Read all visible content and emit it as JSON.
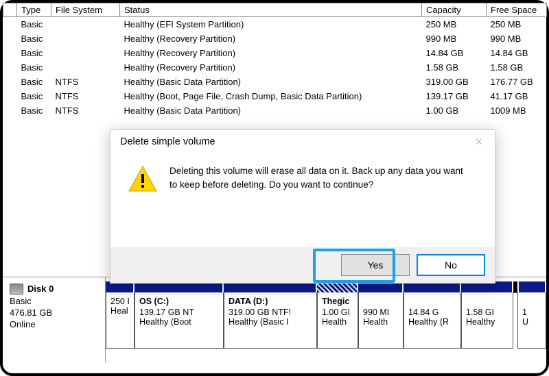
{
  "columns": {
    "type": "Type",
    "fs": "File System",
    "status": "Status",
    "capacity": "Capacity",
    "free": "Free Space"
  },
  "rows": [
    {
      "type": "Basic",
      "fs": "",
      "status": "Healthy (EFI System Partition)",
      "cap": "250 MB",
      "free": "250 MB"
    },
    {
      "type": "Basic",
      "fs": "",
      "status": "Healthy (Recovery Partition)",
      "cap": "990 MB",
      "free": "990 MB"
    },
    {
      "type": "Basic",
      "fs": "",
      "status": "Healthy (Recovery Partition)",
      "cap": "14.84 GB",
      "free": "14.84 GB"
    },
    {
      "type": "Basic",
      "fs": "",
      "status": "Healthy (Recovery Partition)",
      "cap": "1.58 GB",
      "free": "1.58 GB"
    },
    {
      "type": "Basic",
      "fs": "NTFS",
      "status": "Healthy (Basic Data Partition)",
      "cap": "319.00 GB",
      "free": "176.77 GB"
    },
    {
      "type": "Basic",
      "fs": "NTFS",
      "status": "Healthy (Boot, Page File, Crash Dump, Basic Data Partition)",
      "cap": "139.17 GB",
      "free": "41.17 GB"
    },
    {
      "type": "Basic",
      "fs": "NTFS",
      "status": "Healthy (Basic Data Partition)",
      "cap": "1.00 GB",
      "free": "1009 MB"
    }
  ],
  "dialog": {
    "title": "Delete simple volume",
    "message": "Deleting this volume will erase all data on it. Back up any data you want to keep before deleting. Do you want to continue?",
    "yes": "Yes",
    "no": "No"
  },
  "disk": {
    "name": "Disk 0",
    "type": "Basic",
    "size": "476.81 GB",
    "state": "Online"
  },
  "parts": {
    "p0_l1": "250 I",
    "p0_l2": "Heal",
    "p1_t": "OS  (C:)",
    "p1_l1": "139.17 GB NT",
    "p1_l2": "Healthy (Boot",
    "p2_t": "DATA  (D:)",
    "p2_l1": "319.00 GB NTF!",
    "p2_l2": "Healthy (Basic I",
    "p3_t": "Thegic",
    "p3_l1": "1.00 GI",
    "p3_l2": "Health",
    "p4_l1": "990 MI",
    "p4_l2": "Health",
    "p5_l1": "14.84 G",
    "p5_l2": "Healthy (R",
    "p6_l1": "1.58 GI",
    "p6_l2": "Healthy",
    "p7_l1": "1",
    "p7_l2": "U"
  }
}
